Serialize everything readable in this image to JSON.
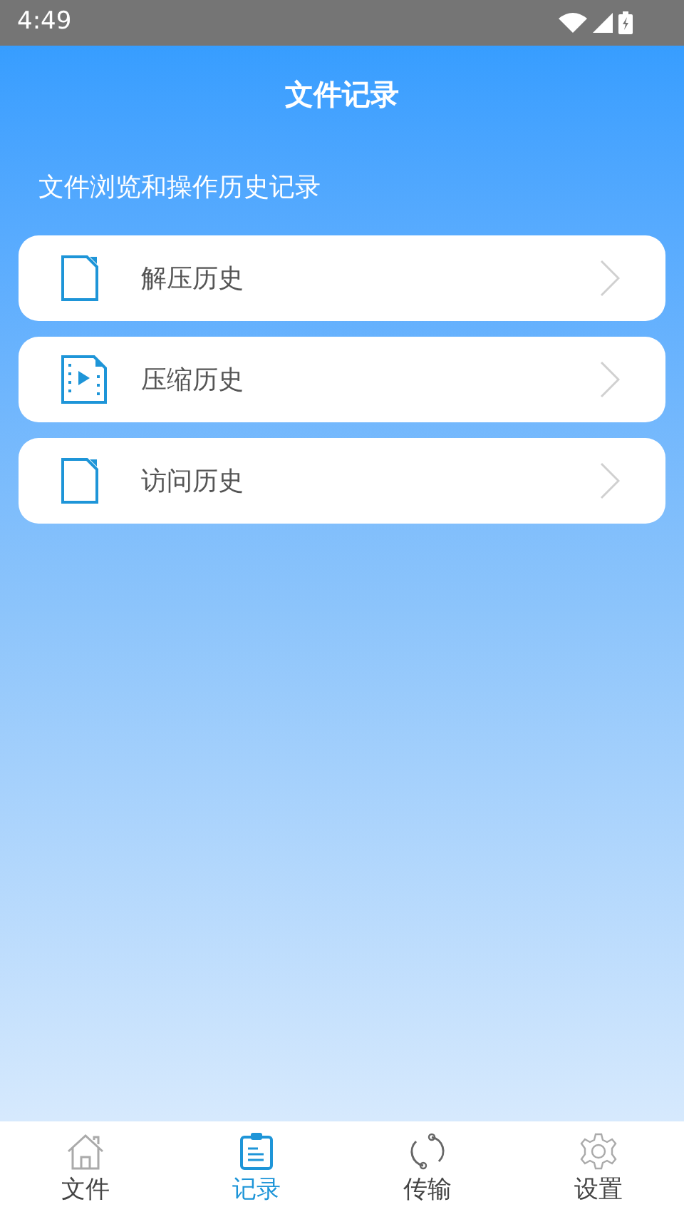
{
  "status_bar": {
    "time": "4:49"
  },
  "header": {
    "title": "文件记录"
  },
  "subtitle": "文件浏览和操作历史记录",
  "items": [
    {
      "label": "解压历史",
      "kind": "file"
    },
    {
      "label": "压缩历史",
      "kind": "video"
    },
    {
      "label": "访问历史",
      "kind": "file"
    }
  ],
  "bottom_nav": [
    {
      "label": "文件",
      "kind": "home",
      "selected": false
    },
    {
      "label": "记录",
      "kind": "records",
      "selected": true
    },
    {
      "label": "传输",
      "kind": "sync",
      "selected": false
    },
    {
      "label": "设置",
      "kind": "settings",
      "selected": false
    }
  ]
}
